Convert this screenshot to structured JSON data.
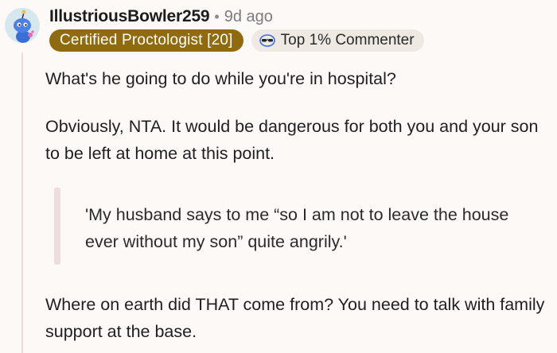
{
  "comment": {
    "username": "IllustriousBowler259",
    "separator": "•",
    "time": "9d ago",
    "flair": "Certified Proctologist [20]",
    "top_badge": "Top 1% Commenter",
    "paragraphs": [
      "What's he going to do while you're in hospital?",
      "Obviously, NTA. It would be dangerous for both you and your son to be left at home at this point.",
      "Where on earth did THAT come from? You need to talk with family support at the base."
    ],
    "quote": "'My husband says to me “so I am not to leave the house ever without my son” quite angrily.'"
  },
  "colors": {
    "background": "#fcf9f6",
    "flair_bg": "#8f6b0e",
    "badge_bg": "#efe9e3",
    "quote_bar": "#f0dede",
    "thread_line": "#ecdcd9"
  },
  "icons": {
    "avatar": "snoo-avatar-icon",
    "top_badge": "sunglasses-icon"
  }
}
